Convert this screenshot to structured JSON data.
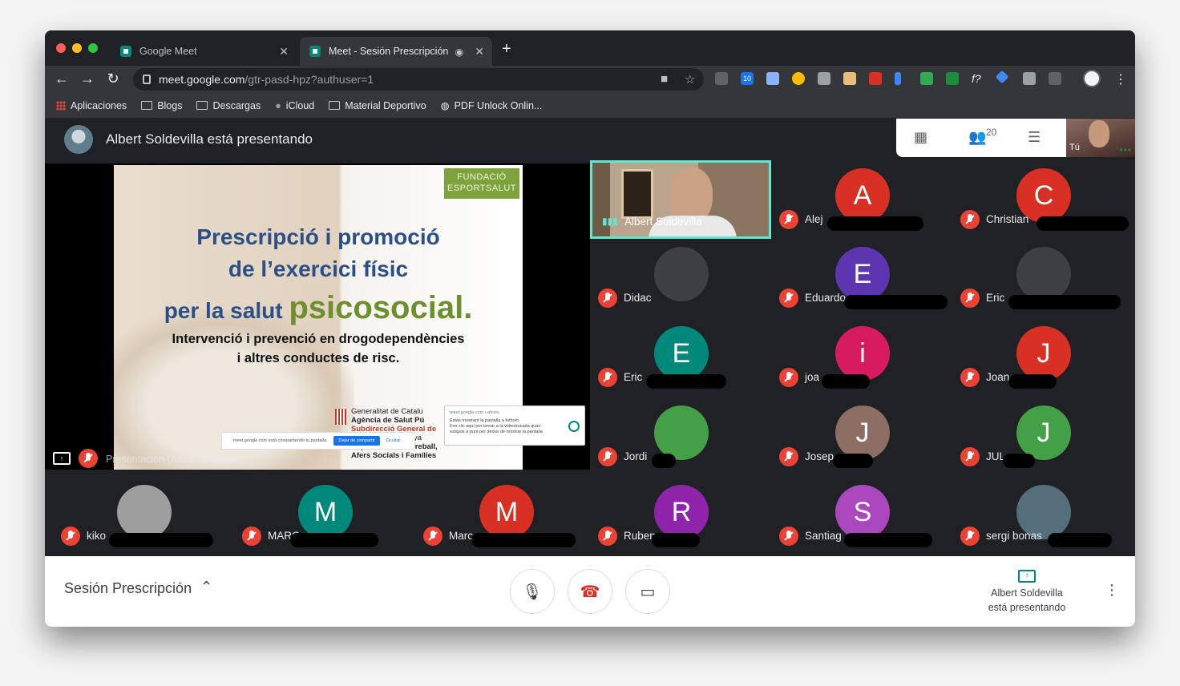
{
  "browser": {
    "tabs": [
      {
        "label": "Google Meet"
      },
      {
        "label": "Meet - Sesión Prescripción"
      }
    ],
    "url_host": "meet.google.com",
    "url_path": "/gtr-pasd-hpz?authuser=1",
    "bookmarks": [
      "Aplicaciones",
      "Blogs",
      "Descargas",
      "iCloud",
      "Material Deportivo",
      "PDF Unlock Onlin..."
    ],
    "ext_badge": "10"
  },
  "meet": {
    "presenter_title": "Albert Soldevilla está presentando",
    "participant_count": "20",
    "self_label": "Tú",
    "stage_label": "Presentación (Albert Soldevilla)",
    "slide": {
      "logo": "FUNDACIÓ ESPORTSALUT",
      "line1": "Prescripció i promoció",
      "line2": "de l’exercici físic",
      "line3_pre": "per la salut ",
      "line3_green": "psicosocial",
      "line3_post": ".",
      "sub1": "Intervenció i prevenció en drogodependències",
      "sub2": "i altres conductes de risc.",
      "gencat1": "Generalitat de Catalu",
      "gencat2": "Agència de Salut Pú",
      "gencat3": "Subdirecció General de",
      "gencat4": "alunya",
      "gencat5": "Departament de Treball,",
      "gencat6": "Afers Socials i Famílies",
      "share_text": "meet.google.com está compartiendo tu pantalla.",
      "share_stop": "Dejar de compartir",
      "share_hide": "Ocultar",
      "notif_head": "meet.google.com • ahora",
      "notif_body1": "Estás mostrant la pantalla a tothom",
      "notif_body2": "Fes clic aquí per tornar a la videotrucada quan",
      "notif_body3": "estiguis a punt per deixar de mostrar la pantalla"
    },
    "speaker_name": "Albert Soldevilla",
    "participants": [
      {
        "name": "Alej",
        "initial": "A",
        "color": "#d93025"
      },
      {
        "name": "Christian",
        "initial": "C",
        "color": "#d93025"
      },
      {
        "name": "Didac",
        "initial": "",
        "color": "#3c4043"
      },
      {
        "name": "Eduardo",
        "initial": "E",
        "color": "#5e35b1"
      },
      {
        "name": "Eric",
        "initial": "",
        "color": "#3c4043"
      },
      {
        "name": "Eric",
        "initial": "E",
        "color": "#00897b"
      },
      {
        "name": "joa",
        "initial": "i",
        "color": "#d81b60"
      },
      {
        "name": "Joan",
        "initial": "J",
        "color": "#d93025"
      },
      {
        "name": "Jordi",
        "initial": "",
        "color": "#43a047"
      },
      {
        "name": "Josep",
        "initial": "J",
        "color": "#8d6e63"
      },
      {
        "name": "JUL",
        "initial": "J",
        "color": "#43a047"
      },
      {
        "name": "kiko",
        "initial": "",
        "color": "#9e9e9e"
      },
      {
        "name": "MARC",
        "initial": "M",
        "color": "#00897b"
      },
      {
        "name": "Marc",
        "initial": "M",
        "color": "#d93025"
      },
      {
        "name": "Ruben",
        "initial": "R",
        "color": "#8e24aa"
      },
      {
        "name": "Santiag",
        "initial": "S",
        "color": "#ab47bc"
      },
      {
        "name": "sergi bonas",
        "initial": "",
        "color": "#546e7a"
      }
    ],
    "meeting_name": "Sesión Prescripción",
    "bottom_present_1": "Albert Soldevilla",
    "bottom_present_2": "está presentando"
  }
}
